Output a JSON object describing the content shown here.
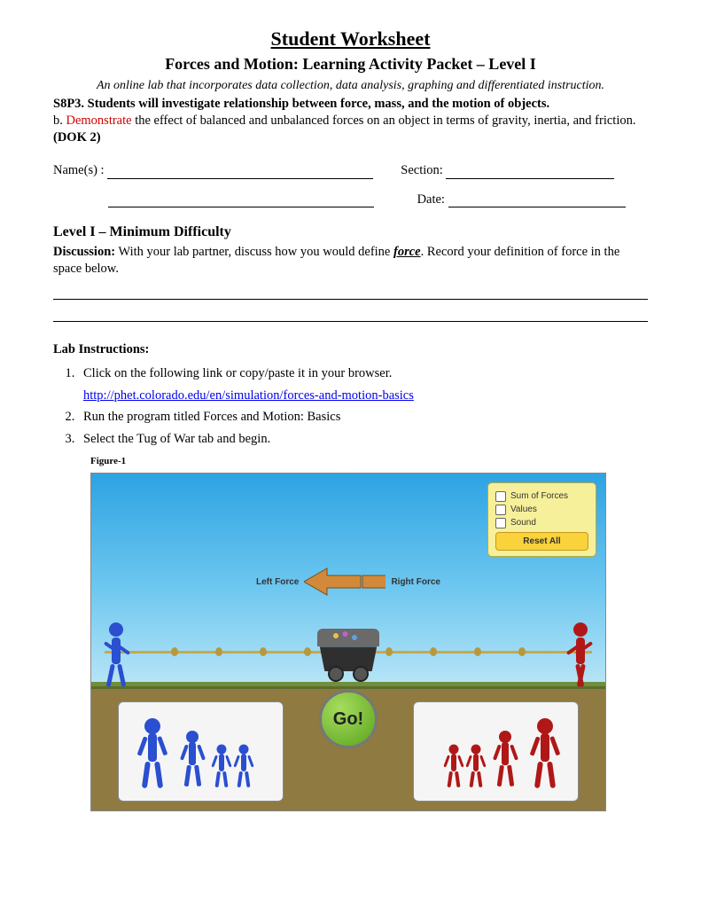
{
  "header": {
    "title": "Student Worksheet",
    "subtitle": "Forces and Motion:  Learning Activity Packet – Level I",
    "intro": "An online lab that incorporates data collection, data analysis, graphing and differentiated instruction.",
    "standard_bold": "S8P3. Students will investigate relationship between force, mass, and the motion of objects.",
    "sub_prefix": "b. ",
    "sub_red": "Demonstrate",
    "sub_rest": " the effect of balanced and unbalanced forces on an object in terms of gravity, inertia, and friction. ",
    "dok": "(DOK 2)"
  },
  "form": {
    "names_label": "Name(s) :",
    "section_label": "Section:",
    "date_label": "Date:"
  },
  "level": {
    "heading": "Level I – Minimum Difficulty",
    "disc_label": "Discussion:",
    "disc_text_a": "  With your lab partner, discuss how you would define ",
    "disc_force": "force",
    "disc_text_b": ".  Record your definition of force in the space below."
  },
  "lab": {
    "heading": "Lab Instructions:",
    "steps": [
      "Click on the following link or copy/paste it in your browser.",
      "Run the program titled Forces and Motion:  Basics",
      "Select the Tug of War tab and begin."
    ],
    "link": "http://phet.colorado.edu/en/simulation/forces-and-motion-basics",
    "figure_label": "Figure-1"
  },
  "sim": {
    "options": [
      "Sum of Forces",
      "Values",
      "Sound"
    ],
    "reset": "Reset All",
    "left_force": "Left Force",
    "right_force": "Right Force",
    "go": "Go!"
  }
}
